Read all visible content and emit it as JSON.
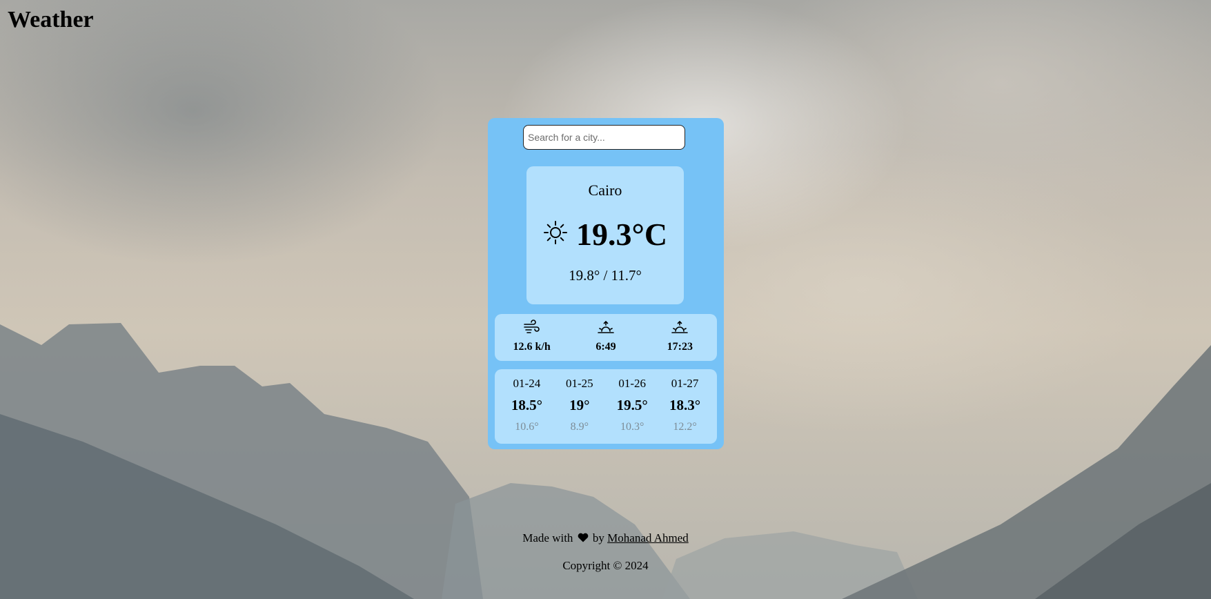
{
  "header": {
    "title": "Weather"
  },
  "search": {
    "placeholder": "Search for a city...",
    "value": ""
  },
  "current": {
    "city": "Cairo",
    "condition_icon": "sun-icon",
    "temperature": "19.3°C",
    "high_low": "19.8° / 11.7°"
  },
  "details": [
    {
      "icon": "wind-icon",
      "value": "12.6 k/h"
    },
    {
      "icon": "sunrise-icon",
      "value": "6:49"
    },
    {
      "icon": "sunset-icon",
      "value": "17:23"
    }
  ],
  "forecast": [
    {
      "date": "01-24",
      "high": "18.5°",
      "low": "10.6°"
    },
    {
      "date": "01-25",
      "high": "19°",
      "low": "8.9°"
    },
    {
      "date": "01-26",
      "high": "19.5°",
      "low": "10.3°"
    },
    {
      "date": "01-27",
      "high": "18.3°",
      "low": "12.2°"
    }
  ],
  "footer": {
    "made_with": "Made with",
    "heart_icon": "heart-icon",
    "by": "by",
    "author": "Mohanad Ahmed",
    "copyright": "Copyright © 2024"
  },
  "colors": {
    "card": "#76c2f6",
    "panel": "#b2e0fd",
    "low_temp": "#7d8c96"
  }
}
